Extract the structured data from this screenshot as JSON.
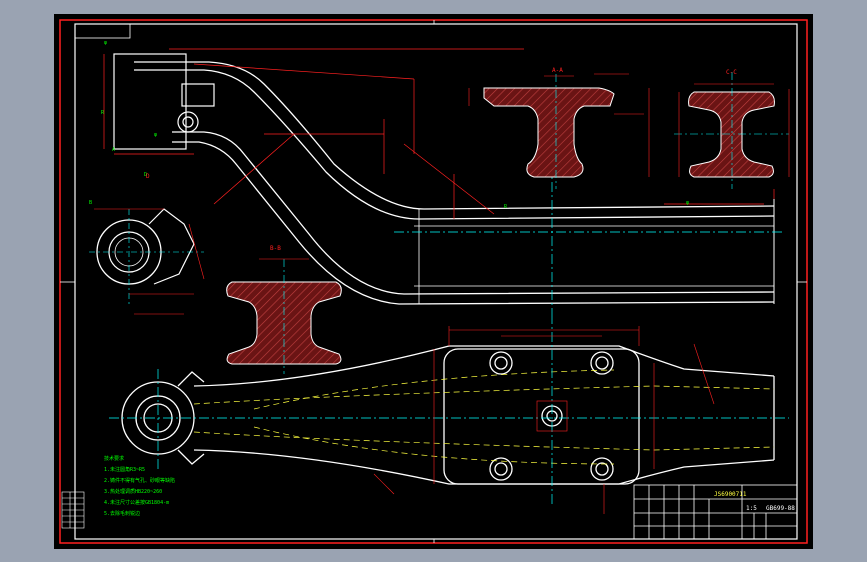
{
  "drawing": {
    "section_labels": [
      "A-A",
      "B-B",
      "C-C",
      "D"
    ],
    "title_block": {
      "drawing_number": "JS6900711",
      "ratio": "1:5",
      "material": "GB699-88"
    },
    "notes_heading": "技术要求",
    "notes": [
      "1.未注圆角R3~R5",
      "2.铸件不得有气孔、砂眼等缺陷",
      "3.热处理调质HB220~260",
      "4.未注尺寸公差按GB1804-m",
      "5.去除毛刺锐边"
    ]
  },
  "colors": {
    "background": "#000000",
    "outline": "#ffffff",
    "dimension": "#ff2020",
    "annotation": "#00ff00",
    "centerline": "#00ffff",
    "hidden": "#ffff40",
    "hatch": "#7a1a1a"
  }
}
